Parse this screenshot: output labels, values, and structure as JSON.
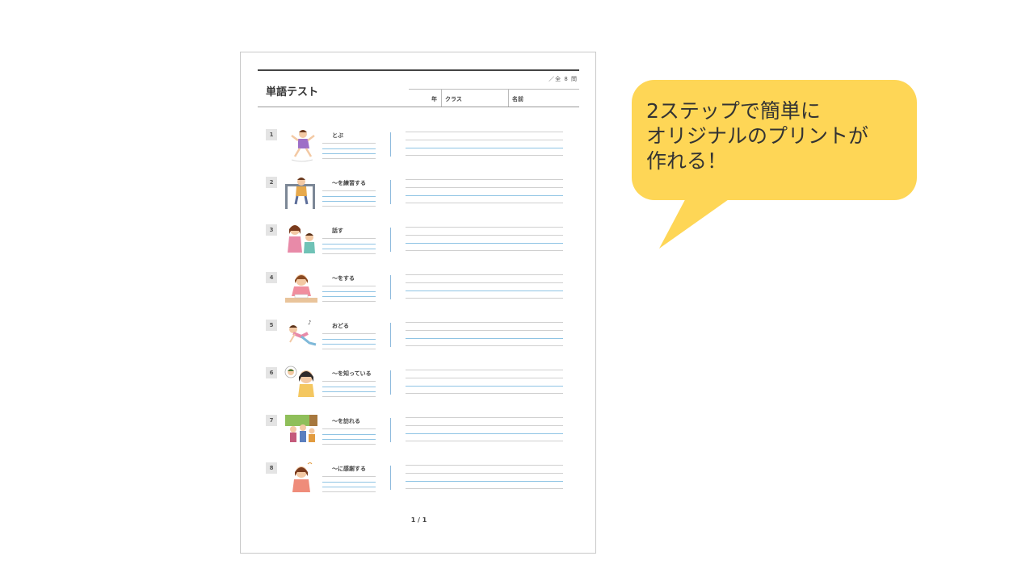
{
  "worksheet": {
    "title": "単語テスト",
    "total": "／全 8 問",
    "header_fields": {
      "year": "年",
      "class": "クラス",
      "name": "名前"
    },
    "page_number": "1 / 1",
    "items": [
      {
        "number": "1",
        "word": "とぶ",
        "illustration": "child-jumping-illustration"
      },
      {
        "number": "2",
        "word": "～を練習する",
        "illustration": "child-on-bar-illustration"
      },
      {
        "number": "3",
        "word": "話す",
        "illustration": "children-talking-illustration"
      },
      {
        "number": "4",
        "word": "～をする",
        "illustration": "girl-studying-illustration"
      },
      {
        "number": "5",
        "word": "おどる",
        "illustration": "child-dancing-illustration"
      },
      {
        "number": "6",
        "word": "～を知っている",
        "illustration": "girl-thinking-illustration"
      },
      {
        "number": "7",
        "word": "～を訪れる",
        "illustration": "family-visiting-illustration"
      },
      {
        "number": "8",
        "word": "～に感謝する",
        "illustration": "girl-thanking-illustration"
      }
    ]
  },
  "callout": {
    "lines": [
      "2ステップで簡単に",
      "オリジナルのプリントが",
      "作れる！"
    ],
    "color": "#fed656"
  }
}
